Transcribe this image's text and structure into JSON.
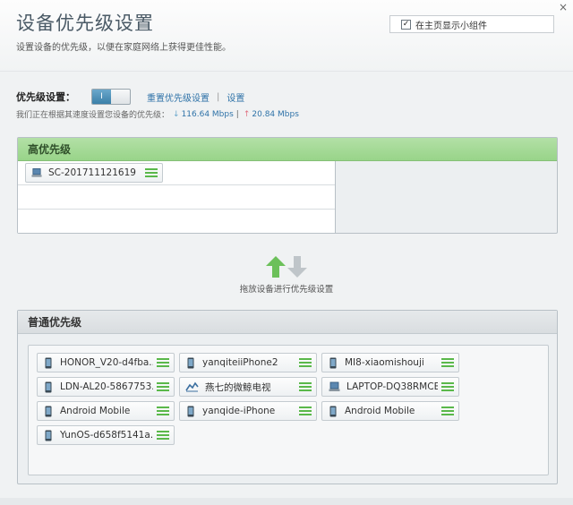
{
  "header": {
    "title": "设备优先级设置",
    "subtitle": "设置设备的优先级，以便在家庭网络上获得更佳性能。",
    "close_glyph": "×",
    "widget_label": "在主页显示小组件",
    "widget_checked": true
  },
  "priority": {
    "label": "优先级设置：",
    "toggle_text": "I",
    "reset_link": "重置优先级设置",
    "separator": "|",
    "settings_link": "设置",
    "speed_prefix": "我们正在根据其速度设置您设备的优先级：",
    "download": "116.64 Mbps",
    "speed_sep": "|",
    "upload": "20.84 Mbps"
  },
  "high_priority": {
    "title": "高优先级",
    "devices": [
      {
        "name": "SC-201711121619",
        "icon": "laptop-icon"
      }
    ]
  },
  "drag_hint": {
    "text": "拖放设备进行优先级设置",
    "up_color": "#6cc05a",
    "down_color": "#bfc5c9"
  },
  "normal_priority": {
    "title": "普通优先级",
    "devices": [
      {
        "name": "HONOR_V20-d4fba...",
        "icon": "phone-icon"
      },
      {
        "name": "yanqiteiiPhone2",
        "icon": "phone-icon"
      },
      {
        "name": "MI8-xiaomishouji",
        "icon": "phone-icon"
      },
      {
        "name": "LDN-AL20-5867753...",
        "icon": "phone-icon"
      },
      {
        "name": "燕七的微鲸电视",
        "icon": "tv-icon"
      },
      {
        "name": "LAPTOP-DQ38RMCB",
        "icon": "laptop-icon"
      },
      {
        "name": "Android Mobile",
        "icon": "phone-icon"
      },
      {
        "name": "yanqide-iPhone",
        "icon": "phone-icon"
      },
      {
        "name": "Android Mobile",
        "icon": "phone-icon"
      },
      {
        "name": "YunOS-d658f5141a...",
        "icon": "phone-icon"
      }
    ]
  },
  "colors": {
    "high_header": "#a8dc98",
    "link": "#2f73a8",
    "grip": "#5ab84a"
  }
}
